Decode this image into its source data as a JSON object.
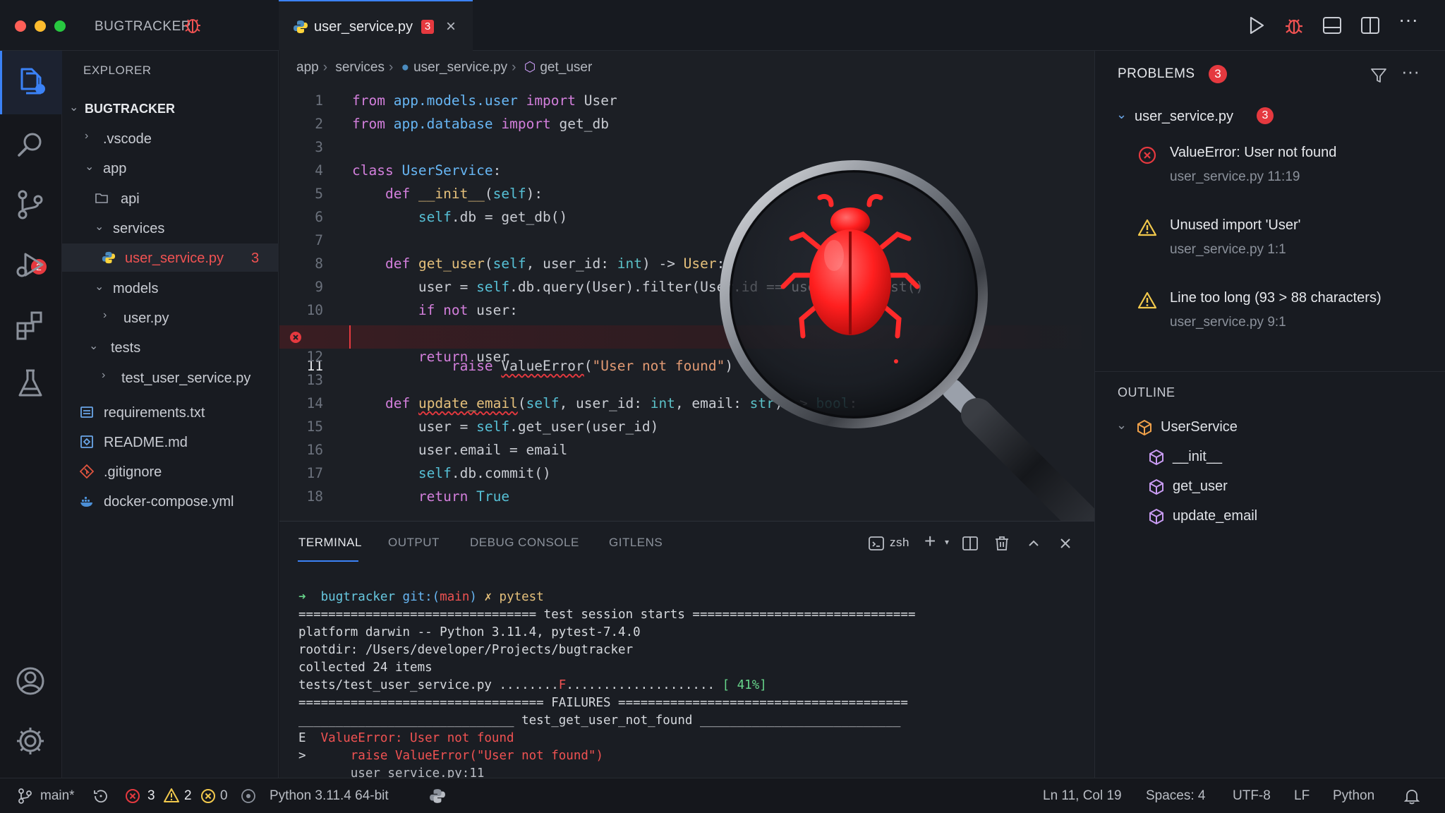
{
  "titlebar": {
    "app_name": "BUGTRACKER",
    "active_tab": {
      "label": "user_service.py",
      "badge": "3"
    }
  },
  "activity_bar": {
    "scm_badge": "2"
  },
  "sidebar": {
    "header": "EXPLORER",
    "root": "BUGTRACKER",
    "items": [
      {
        "label": ".vscode"
      },
      {
        "label": "app"
      },
      {
        "label": "api"
      },
      {
        "label": "services"
      },
      {
        "label": "user_service.py",
        "count": "3"
      },
      {
        "label": "models"
      },
      {
        "label": "user.py"
      },
      {
        "label": "tests"
      },
      {
        "label": "test_user_service.py"
      },
      {
        "label": "requirements.txt"
      },
      {
        "label": "README.md"
      },
      {
        "label": ".gitignore"
      },
      {
        "label": "docker-compose.yml"
      }
    ]
  },
  "editor": {
    "breadcrumb": [
      "app",
      "services",
      "user_service.py",
      "get_user"
    ],
    "lines": [
      "1",
      "2",
      "3",
      "4",
      "5",
      "6",
      "7",
      "8",
      "9",
      "10",
      "11",
      "12",
      "13",
      "14",
      "15",
      "16",
      "17",
      "18"
    ]
  },
  "panel": {
    "tabs": [
      "TERMINAL",
      "OUTPUT",
      "DEBUG CONSOLE",
      "GITLENS"
    ],
    "shell": "zsh",
    "terminal": {
      "l1_dir": "bugtracker",
      "l1_git": "git:(",
      "l1_branch": "main",
      "l1_close": ")",
      "l1_cmd": "✗ pytest",
      "l2": "================================ test session starts ==============================",
      "l3": "platform darwin -- Python 3.11.4, pytest-7.4.0",
      "l4": "rootdir: /Users/developer/Projects/bugtracker",
      "l5": "collected 24 items",
      "l6_a": "tests/test_user_service.py ........",
      "l6_f": "F",
      "l6_b": ".................... ",
      "l6_pct": "[ 41%]",
      "l7": "================================= FAILURES =======================================",
      "l8": "_____________________________ test_get_user_not_found ___________________________",
      "l9_a": "E  ",
      "l9_b": "ValueError: User not found",
      "l10_a": ">      ",
      "l10_b": "raise ValueError(\"User not found\")",
      "l11": "       user_service.py:11"
    }
  },
  "problems": {
    "title": "PROBLEMS",
    "count": "3",
    "file": "user_service.py",
    "file_count": "3",
    "items": [
      {
        "message": "ValueError: User not found",
        "location": "user_service.py  11:19",
        "severity": "error"
      },
      {
        "message": "Unused import 'User'",
        "location": "user_service.py  1:1",
        "severity": "warning"
      },
      {
        "message": "Line too long (93 > 88 characters)",
        "location": "user_service.py  9:1",
        "severity": "warning"
      }
    ]
  },
  "outline": {
    "title": "OUTLINE",
    "class_name": "UserService",
    "methods": [
      "__init__",
      "get_user",
      "update_email"
    ]
  },
  "statusbar": {
    "branch": "main*",
    "errors": "3",
    "warnings": "2",
    "infos": "0",
    "python": "Python  3.11.4  64-bit",
    "position": "Ln 11, Col 19",
    "spaces": "Spaces: 4",
    "encoding": "UTF-8",
    "eol": "LF",
    "language": "Python"
  },
  "colors": {
    "accent": "#3b82f6",
    "error": "#e5393f",
    "warning": "#f2c94c",
    "bug": "#ff2a2a"
  }
}
